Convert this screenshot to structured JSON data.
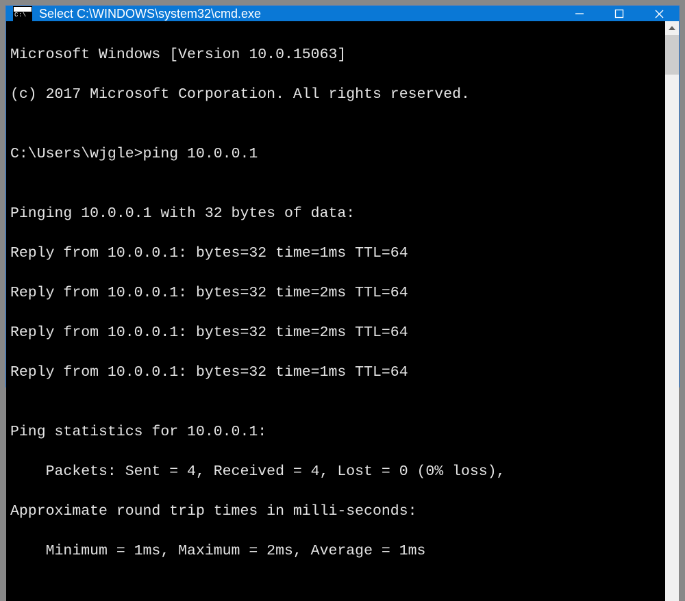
{
  "titlebar": {
    "icon_text": "C:\\",
    "title": "Select C:\\WINDOWS\\system32\\cmd.exe"
  },
  "terminal": {
    "header1": "Microsoft Windows [Version 10.0.15063]",
    "header2": "(c) 2017 Microsoft Corporation. All rights reserved.",
    "blank": "",
    "prompt": "C:\\Users\\wjgle>",
    "command": "ping 10.0.0.1",
    "ping_header": "Pinging 10.0.0.1 with 32 bytes of data:",
    "reply1": "Reply from 10.0.0.1: bytes=32 time=1ms TTL=64",
    "reply2": "Reply from 10.0.0.1: bytes=32 time=2ms TTL=64",
    "reply3": "Reply from 10.0.0.1: bytes=32 time=2ms TTL=64",
    "reply4": "Reply from 10.0.0.1: bytes=32 time=1ms TTL=64",
    "stats_header": "Ping statistics for 10.0.0.1:",
    "stats_packets": "Packets: Sent = 4, Received = 4, Lost = 0 (0% loss),",
    "rtt_header": "Approximate round trip times in milli-seconds:",
    "rtt_values": "Minimum = 1ms, Maximum = 2ms, Average = 1ms"
  }
}
